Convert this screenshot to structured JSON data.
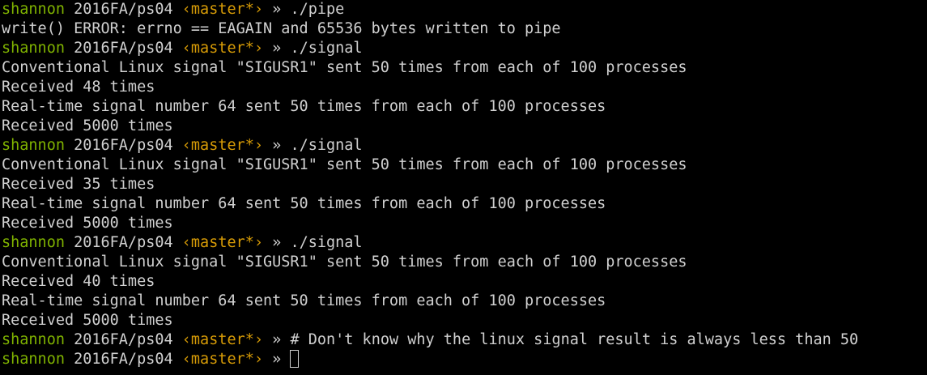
{
  "prompt": {
    "user": "shannon",
    "path": "2016FA/ps04",
    "branch": "‹master*›",
    "separator": "»"
  },
  "lines": [
    {
      "type": "prompt",
      "command": "./pipe"
    },
    {
      "type": "output",
      "text": "write() ERROR: errno == EAGAIN and 65536 bytes written to pipe"
    },
    {
      "type": "prompt",
      "command": "./signal"
    },
    {
      "type": "output",
      "text": "Conventional Linux signal \"SIGUSR1\" sent 50 times from each of 100 processes"
    },
    {
      "type": "output",
      "text": "Received 48 times"
    },
    {
      "type": "output",
      "text": "Real-time signal number 64 sent 50 times from each of 100 processes"
    },
    {
      "type": "output",
      "text": "Received 5000 times"
    },
    {
      "type": "prompt",
      "command": "./signal"
    },
    {
      "type": "output",
      "text": "Conventional Linux signal \"SIGUSR1\" sent 50 times from each of 100 processes"
    },
    {
      "type": "output",
      "text": "Received 35 times"
    },
    {
      "type": "output",
      "text": "Real-time signal number 64 sent 50 times from each of 100 processes"
    },
    {
      "type": "output",
      "text": "Received 5000 times"
    },
    {
      "type": "prompt",
      "command": "./signal"
    },
    {
      "type": "output",
      "text": "Conventional Linux signal \"SIGUSR1\" sent 50 times from each of 100 processes"
    },
    {
      "type": "output",
      "text": "Received 40 times"
    },
    {
      "type": "output",
      "text": "Real-time signal number 64 sent 50 times from each of 100 processes"
    },
    {
      "type": "output",
      "text": "Received 5000 times"
    },
    {
      "type": "prompt",
      "command": "# Don't know why the linux signal result is always less than 50"
    },
    {
      "type": "prompt",
      "command": "",
      "cursor": true
    }
  ],
  "colors": {
    "background": "#000000",
    "foreground": "#d0d0d0",
    "user": "#7fb200",
    "branch": "#d79b06"
  }
}
